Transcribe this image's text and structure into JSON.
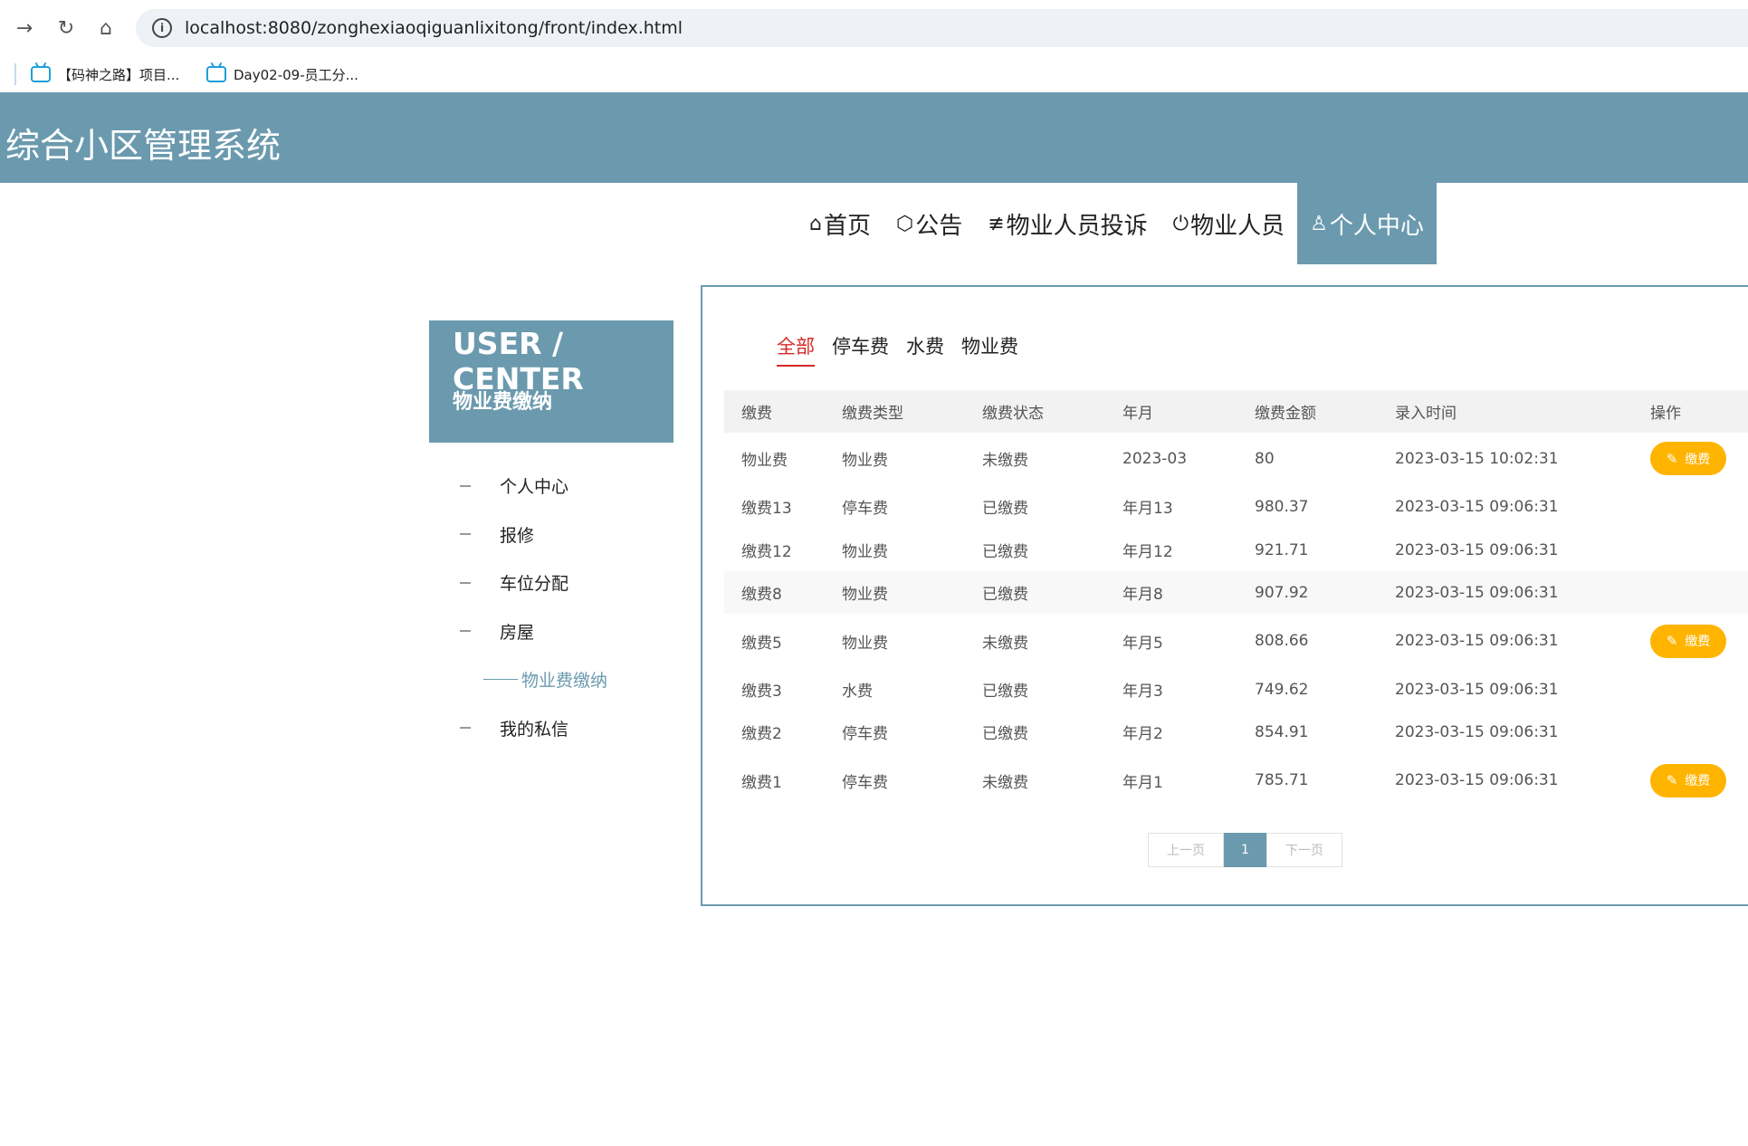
{
  "browser": {
    "url": "localhost:8080/zonghexiaoqiguanlixitong/front/index.html",
    "bookmarks": [
      {
        "label": "【码神之路】项目..."
      },
      {
        "label": "Day02-09-员工分..."
      }
    ]
  },
  "site": {
    "title": "综合小区管理系统"
  },
  "nav": {
    "items": [
      {
        "label": "首页"
      },
      {
        "label": "公告"
      },
      {
        "label": "物业人员投诉"
      },
      {
        "label": "物业人员"
      },
      {
        "label": "个人中心"
      }
    ]
  },
  "user_center": {
    "title": "USER / CENTER",
    "subtitle": "物业费缴纳",
    "menu": [
      {
        "label": "个人中心"
      },
      {
        "label": "报修"
      },
      {
        "label": "车位分配"
      },
      {
        "label": "房屋"
      },
      {
        "label": "物业费缴纳"
      },
      {
        "label": "我的私信"
      }
    ]
  },
  "filters": {
    "tabs": [
      {
        "label": "全部"
      },
      {
        "label": "停车费"
      },
      {
        "label": "水费"
      },
      {
        "label": "物业费"
      }
    ]
  },
  "table": {
    "headers": [
      "缴费",
      "缴费类型",
      "缴费状态",
      "年月",
      "缴费金额",
      "录入时间",
      "操作"
    ],
    "rows": [
      [
        "物业费",
        "物业费",
        "未缴费",
        "2023-03",
        "80",
        "2023-03-15 10:02:31"
      ],
      [
        "缴费13",
        "停车费",
        "已缴费",
        "年月13",
        "980.37",
        "2023-03-15 09:06:31"
      ],
      [
        "缴费12",
        "物业费",
        "已缴费",
        "年月12",
        "921.71",
        "2023-03-15 09:06:31"
      ],
      [
        "缴费8",
        "物业费",
        "已缴费",
        "年月8",
        "907.92",
        "2023-03-15 09:06:31"
      ],
      [
        "缴费5",
        "物业费",
        "未缴费",
        "年月5",
        "808.66",
        "2023-03-15 09:06:31"
      ],
      [
        "缴费3",
        "水费",
        "已缴费",
        "年月3",
        "749.62",
        "2023-03-15 09:06:31"
      ],
      [
        "缴费2",
        "停车费",
        "已缴费",
        "年月2",
        "854.91",
        "2023-03-15 09:06:31"
      ],
      [
        "缴费1",
        "停车费",
        "未缴费",
        "年月1",
        "785.71",
        "2023-03-15 09:06:31"
      ]
    ],
    "pay_label": "缴费"
  },
  "pager": {
    "prev": "上一页",
    "current": "1",
    "next": "下一页"
  },
  "colors": {
    "accent": "#6b9aae",
    "active_filter": "#d62828",
    "pay_button": "#ffb400"
  }
}
